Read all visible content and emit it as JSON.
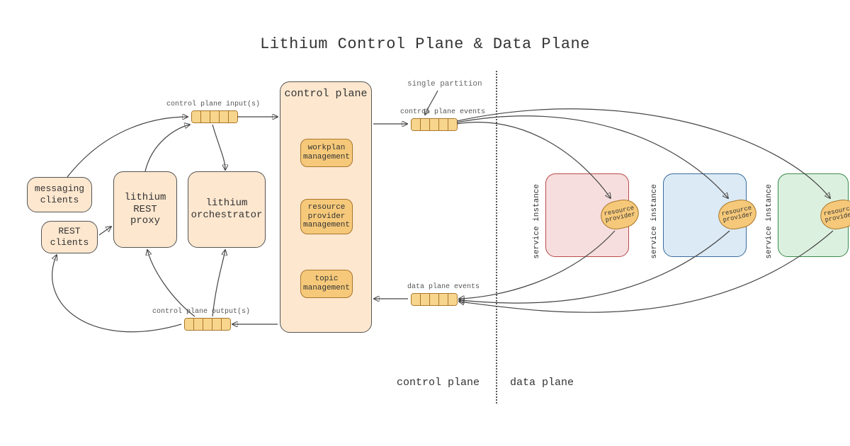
{
  "title": "Lithium Control Plane & Data Plane",
  "clients": {
    "messaging": "messaging\nclients",
    "rest": "REST\nclients"
  },
  "services": {
    "rest_proxy": "lithium\nREST\nproxy",
    "orchestrator": "lithium\norchestrator"
  },
  "control_plane": {
    "header": "control plane",
    "inner": {
      "workplan": "workplan\nmanagement",
      "resource": "resource\nprovider\nmanagement",
      "topic": "topic\nmanagement"
    }
  },
  "queues": {
    "inputs_label": "control plane input(s)",
    "outputs_label": "control plane output(s)",
    "cp_events_label": "control plane events",
    "dp_events_label": "data plane events"
  },
  "annotations": {
    "single_partition": "single partition"
  },
  "sections": {
    "left": "control plane",
    "right": "data plane"
  },
  "instances": {
    "label": "service instance",
    "rp_label": "resource\nprovider"
  }
}
